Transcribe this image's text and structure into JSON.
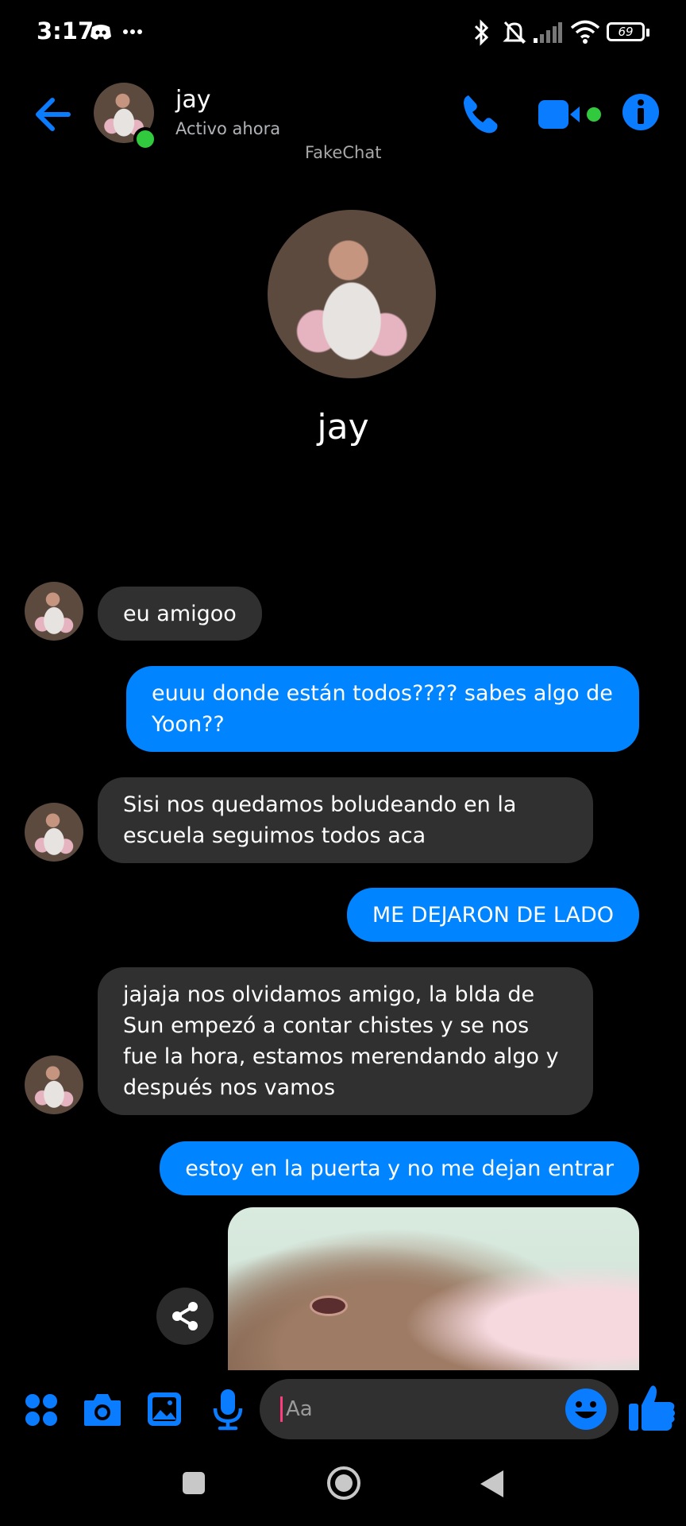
{
  "status_bar": {
    "time": "3:17",
    "battery": "69",
    "icons": [
      "discord-icon",
      "more-dots-icon",
      "bluetooth-icon",
      "bell-muted-icon",
      "signal-icon",
      "wifi-icon",
      "battery-icon"
    ]
  },
  "header": {
    "name": "jay",
    "status": "Activo ahora",
    "watermark": "FakeChat"
  },
  "profile": {
    "name": "jay"
  },
  "messages": [
    {
      "side": "incoming",
      "text": "eu amigoo"
    },
    {
      "side": "outgoing",
      "text": "euuu donde están todos???? sabes algo de Yoon??"
    },
    {
      "side": "incoming",
      "text": "Sisi nos quedamos boludeando en la escuela seguimos todos aca"
    },
    {
      "side": "outgoing",
      "text": "ME DEJARON DE LADO"
    },
    {
      "side": "incoming",
      "text": "jajaja nos olvidamos amigo, la blda de Sun empezó a contar chistes y se nos fue la hora, estamos merendando algo y después nos vamos"
    },
    {
      "side": "outgoing",
      "text": "estoy en la puerta y no me dejan entrar"
    },
    {
      "side": "outgoing",
      "type": "image"
    }
  ],
  "composer": {
    "placeholder": "Aa"
  },
  "colors": {
    "accent": "#0084ff",
    "incoming_bubble": "#303030",
    "online": "#31c93d"
  }
}
